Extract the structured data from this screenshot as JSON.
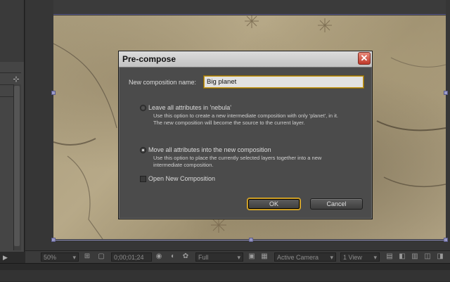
{
  "dialog": {
    "title": "Pre-compose",
    "name_label": "New composition name:",
    "name_value": "Big planet",
    "option1_label": "Leave all attributes in 'nebula'",
    "option1_desc1": "Use this option to create a new intermediate composition with only 'planet', in it.",
    "option1_desc2": "The new composition will become the source to the current layer.",
    "option1_selected": false,
    "option2_label": "Move all attributes into the new composition",
    "option2_desc1": "Use this option to place the currently selected layers together into a new",
    "option2_desc2": "intermediate composition.",
    "option2_selected": true,
    "open_new_label": "Open New Composition",
    "open_new_checked": false,
    "ok_label": "OK",
    "cancel_label": "Cancel"
  },
  "viewer_toolbar": {
    "zoom": "50%",
    "timecode": "0;00;01;24",
    "resolution": "Full",
    "camera": "Active Camera",
    "views": "1 View"
  },
  "colors": {
    "accent_focus": "#c79a1f",
    "close_button": "#c0392b",
    "mask_outline": "#9a9ac8"
  }
}
